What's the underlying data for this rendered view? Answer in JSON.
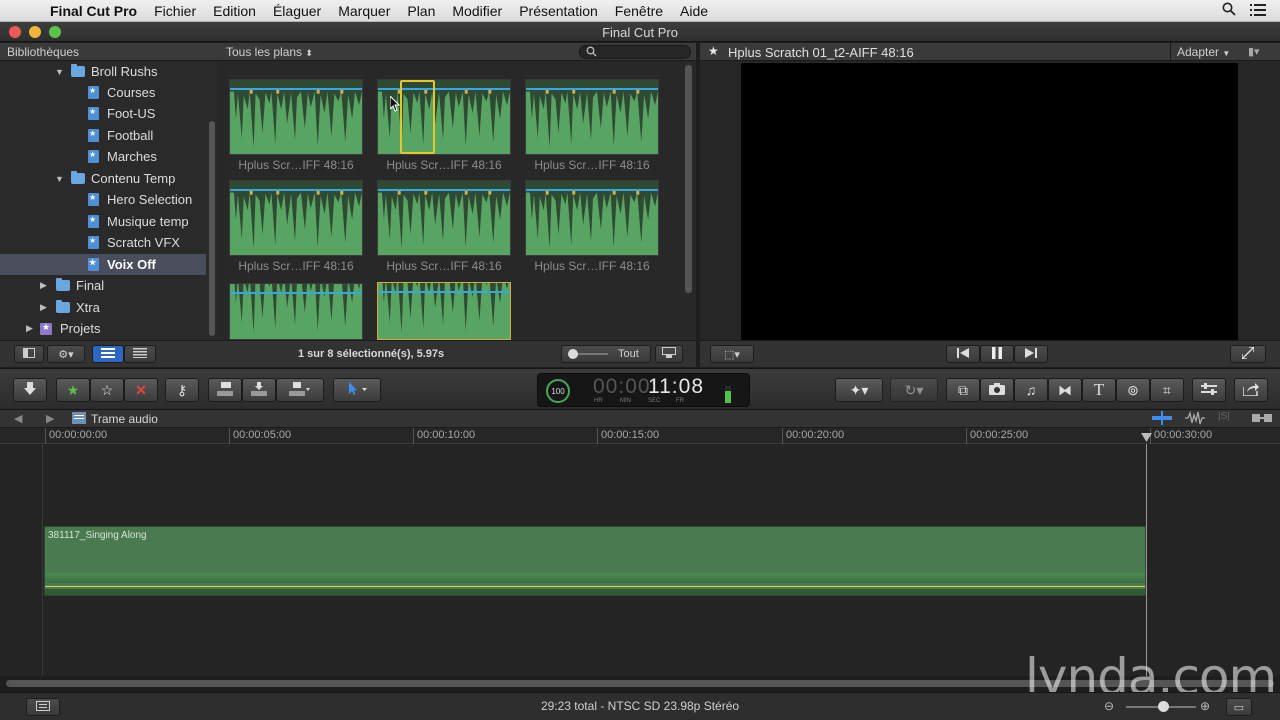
{
  "menubar": {
    "app_name": "Final Cut Pro",
    "menus": [
      "Fichier",
      "Edition",
      "Élaguer",
      "Marquer",
      "Plan",
      "Modifier",
      "Présentation",
      "Fenêtre",
      "Aide"
    ]
  },
  "window": {
    "title": "Final Cut Pro"
  },
  "library": {
    "header": "Bibliothèques",
    "items": [
      {
        "label": "Broll Rushs",
        "kind": "folder"
      },
      {
        "label": "Courses",
        "kind": "event"
      },
      {
        "label": "Foot-US",
        "kind": "event"
      },
      {
        "label": "Football",
        "kind": "event"
      },
      {
        "label": "Marches",
        "kind": "event"
      },
      {
        "label": "Contenu Temp",
        "kind": "folder"
      },
      {
        "label": "Hero Selection",
        "kind": "event"
      },
      {
        "label": "Musique temp",
        "kind": "event"
      },
      {
        "label": "Scratch VFX",
        "kind": "event"
      },
      {
        "label": "Voix Off",
        "kind": "event",
        "selected": true
      },
      {
        "label": "Final",
        "kind": "folder"
      },
      {
        "label": "Xtra",
        "kind": "folder"
      },
      {
        "label": "Projets",
        "kind": "project"
      }
    ]
  },
  "browser": {
    "filter": "Tous les plans",
    "clips": [
      "Hplus Scr…IFF 48:16",
      "Hplus Scr…IFF 48:16",
      "Hplus Scr…IFF 48:16",
      "Hplus Scr…IFF 48:16",
      "Hplus Scr…IFF 48:16",
      "Hplus Scr…IFF 48:16"
    ],
    "selection_status": "1 sur 8 sélectionné(s), 5.97s",
    "zoom_label": "Tout"
  },
  "viewer": {
    "clip_title": "Hplus Scratch 01_t2-AIFF 48:16",
    "zoom": "Adapter"
  },
  "toolbar": {
    "timecode": "11:08",
    "timecode_fields": [
      "HR",
      "MIN",
      "SEC",
      "FR"
    ],
    "speed": "100"
  },
  "timeline": {
    "title": "Trame audio",
    "ruler": [
      "00:00:00:00",
      "00:00:05:00",
      "00:00:10:00",
      "00:00:15:00",
      "00:00:20:00",
      "00:00:25:00",
      "00:00:30:00"
    ],
    "clip_name": "381117_Singing Along"
  },
  "status": {
    "text": "29:23 total - NTSC SD 23.98p Stéréo"
  },
  "watermark": "lynda.com",
  "colors": {
    "waveform": "#4f9b5a",
    "selection": "#e6c62a",
    "accent_blue": "#38a6e6"
  }
}
